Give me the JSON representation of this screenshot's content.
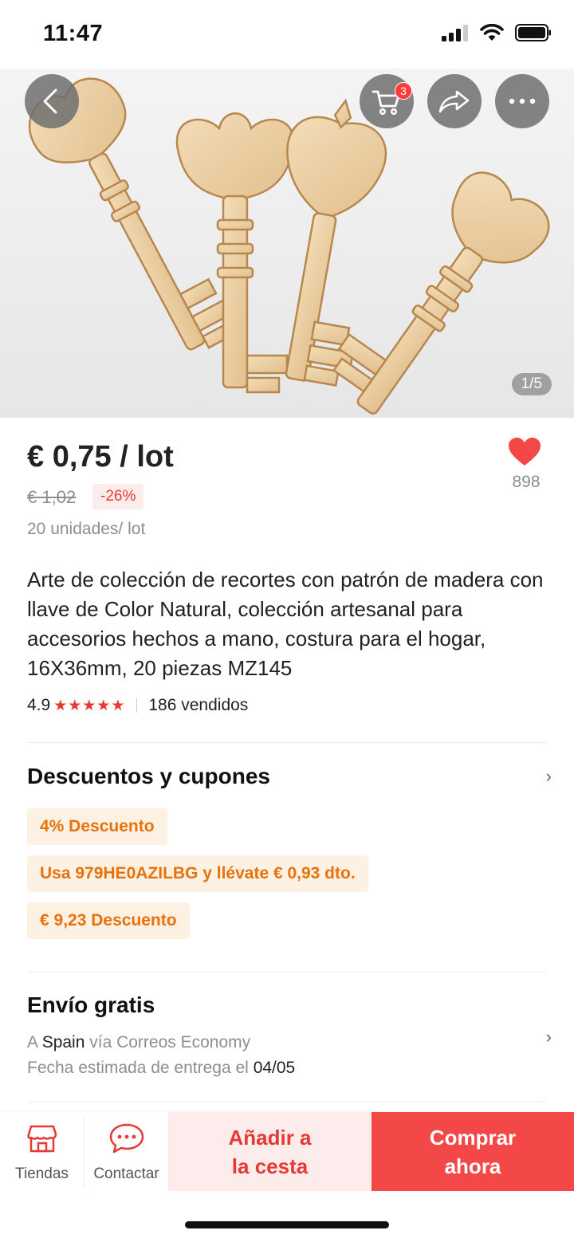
{
  "status_bar": {
    "time": "11:47",
    "icons": [
      "signal-icon",
      "wifi-icon",
      "battery-icon"
    ]
  },
  "header": {
    "back_icon": "chevron-left-icon",
    "cart_icon": "cart-icon",
    "cart_count": "3",
    "share_icon": "share-icon",
    "more_icon": "more-icon",
    "image_counter": "1/5"
  },
  "product": {
    "price": "€ 0,75 / lot",
    "old_price": "€ 1,02",
    "discount": "-26%",
    "unit_info": "20 unidades/ lot",
    "wishlist_count": "898",
    "title": "Arte de colección de recortes con patrón de madera con llave de Color Natural, colección artesanal para accesorios hechos a mano, costura para el hogar, 16X36mm, 20 piezas MZ145",
    "rating": "4.9",
    "stars": "★★★★★",
    "sold": "186 vendidos"
  },
  "discounts": {
    "title": "Descuentos y cupones",
    "coupons": [
      "4% Descuento",
      "Usa 979HE0AZILBG y llévate € 0,93 dto.",
      "€ 9,23 Descuento"
    ]
  },
  "shipping": {
    "title": "Envío gratis",
    "to_prefix": "A ",
    "country": "Spain",
    "method": " vía Correos Economy",
    "eta_prefix": "Fecha estimada de entrega el ",
    "eta_date": "04/05"
  },
  "bottom_bar": {
    "stores_label": "Tiendas",
    "contact_label": "Contactar",
    "add_to_cart": "Añadir a la cesta",
    "buy_now": "Comprar ahora"
  },
  "colors": {
    "accent_red": "#f44848",
    "coupon_orange": "#e8710a",
    "coupon_bg": "#fdf1e3"
  }
}
